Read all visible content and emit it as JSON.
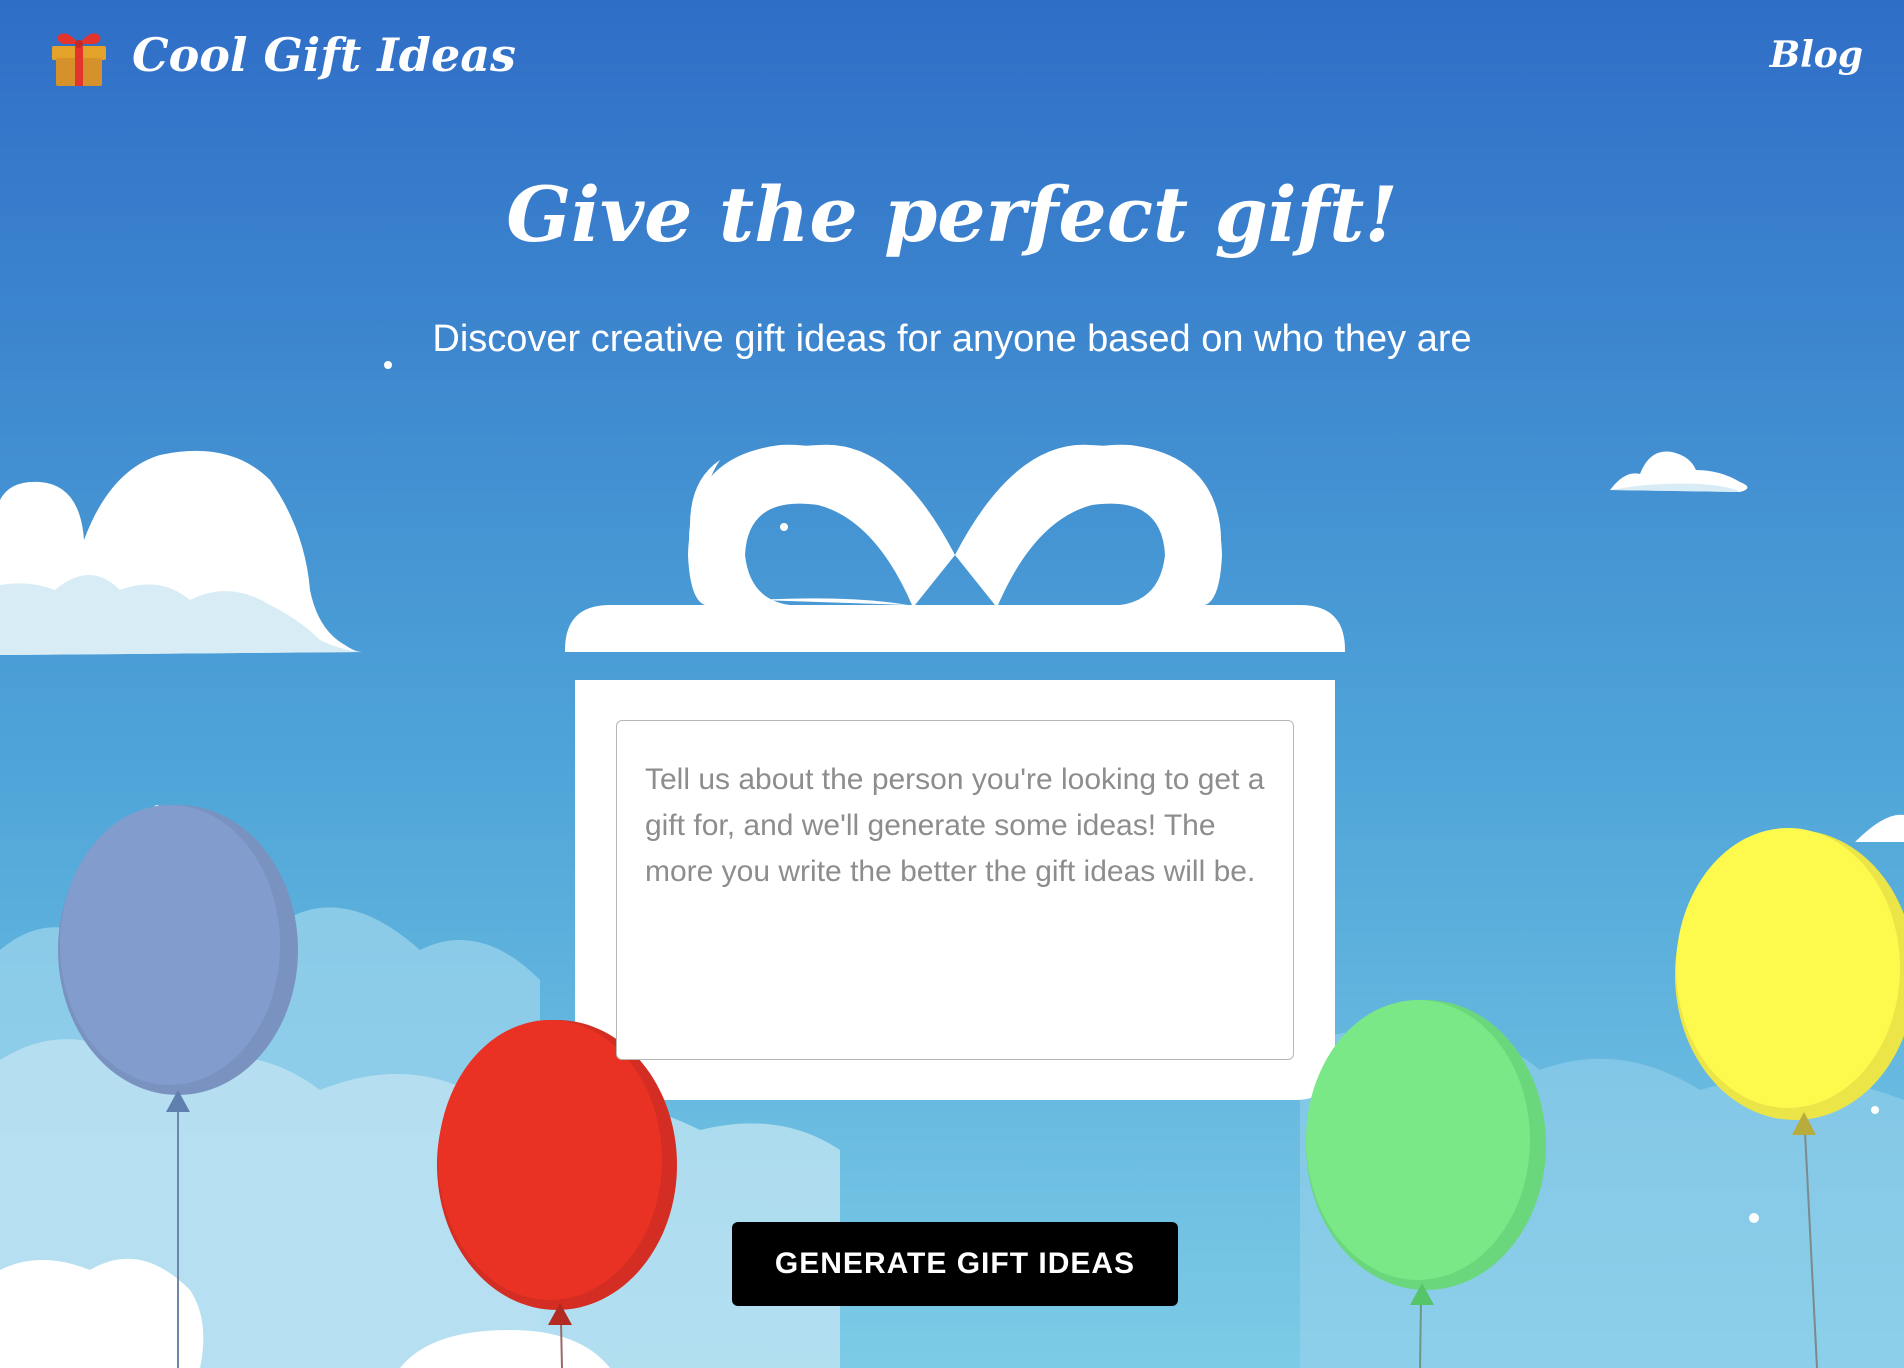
{
  "header": {
    "logo_text": "Cool Gift Ideas",
    "logo_icon": "gift-box-icon",
    "nav_blog": "Blog"
  },
  "hero": {
    "title": "Give the perfect gift!",
    "subtitle": "Discover creative gift ideas for anyone based on who they are"
  },
  "form": {
    "placeholder": "Tell us about the person you're looking to get a gift for, and we'll generate some ideas! The more you write the better the gift ideas will be.",
    "value": "",
    "button_label": "GENERATE GIFT IDEAS"
  },
  "decorations": {
    "balloons": [
      {
        "name": "purple-balloon",
        "color": "#7f9bcb"
      },
      {
        "name": "red-balloon",
        "color": "#e93223"
      },
      {
        "name": "green-balloon",
        "color": "#7ae886"
      },
      {
        "name": "yellow-balloon",
        "color": "#fdf94d"
      }
    ]
  },
  "colors": {
    "sky_top": "#2f6ec7",
    "sky_bottom": "#7ccbe6",
    "gift_box": "#ffffff",
    "button": "#000000"
  }
}
